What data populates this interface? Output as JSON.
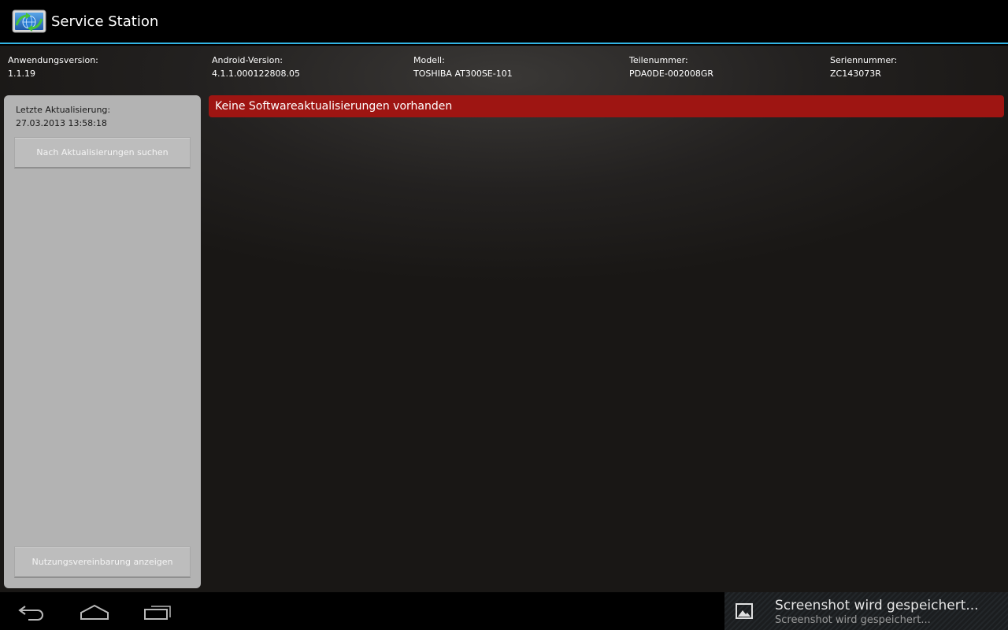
{
  "app": {
    "title": "Service Station",
    "icon": "globe-refresh-icon"
  },
  "device_info": [
    {
      "label": "Anwendungsversion:",
      "value": "1.1.19"
    },
    {
      "label": "Android-Version:",
      "value": "4.1.1.000122808.05"
    },
    {
      "label": "Modell:",
      "value": "TOSHIBA AT300SE-101"
    },
    {
      "label": "Teilenummer:",
      "value": "PDA0DE-002008GR"
    },
    {
      "label": "Seriennummer:",
      "value": "ZC143073R"
    }
  ],
  "side_panel": {
    "last_update_label": "Letzte Aktualisierung:",
    "last_update_value": "27.03.2013 13:58:18",
    "search_button": "Nach Aktualisierungen suchen",
    "terms_button": "Nutzungsvereinbarung anzeigen"
  },
  "status_banner": {
    "text": "Keine Softwareaktualisierungen vorhanden",
    "color": "#9e1512"
  },
  "notification": {
    "title": "Screenshot wird gespeichert...",
    "subtitle": "Screenshot wird gespeichert...",
    "icon": "image-icon"
  },
  "nav": {
    "back_icon": "back-icon",
    "home_icon": "home-icon",
    "recent_icon": "recent-apps-icon"
  },
  "colors": {
    "accent": "#33b5e5",
    "panel": "#b3b3b3"
  }
}
